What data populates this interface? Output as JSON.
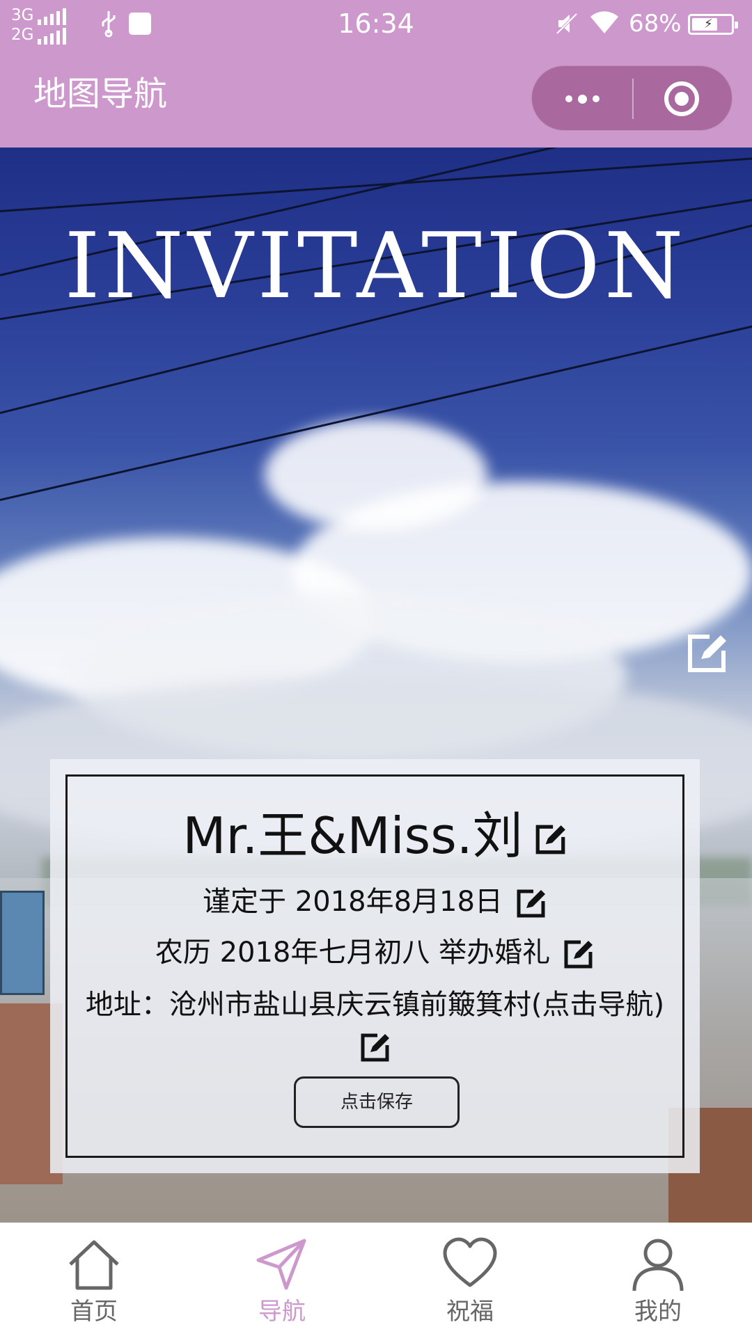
{
  "status_bar": {
    "network_top": "3G",
    "network_bottom": "2G",
    "time": "16:34",
    "battery_percent": "68%",
    "battery_level": 0.68
  },
  "nav_bar": {
    "title": "地图导航",
    "more_icon": "more-dots-icon",
    "close_icon": "target-circle-icon"
  },
  "hero": {
    "title": "INVITATION",
    "edit_icon": "edit-icon"
  },
  "card": {
    "names": "Mr.王&Miss.刘",
    "date": "谨定于 2018年8月18日",
    "lunar": "农历 2018年七月初八 举办婚礼",
    "address": "地址：沧州市盐山县庆云镇前簸箕村(点击导航)",
    "save_label": "点击保存"
  },
  "tabs": [
    {
      "label": "首页",
      "icon": "home-icon",
      "active": false
    },
    {
      "label": "导航",
      "icon": "navigation-arrow-icon",
      "active": true
    },
    {
      "label": "祝福",
      "icon": "heart-icon",
      "active": false
    },
    {
      "label": "我的",
      "icon": "user-icon",
      "active": false
    }
  ],
  "colors": {
    "accent": "#cd98cc",
    "capsule": "#a9699e",
    "tab_inactive": "#666666"
  }
}
